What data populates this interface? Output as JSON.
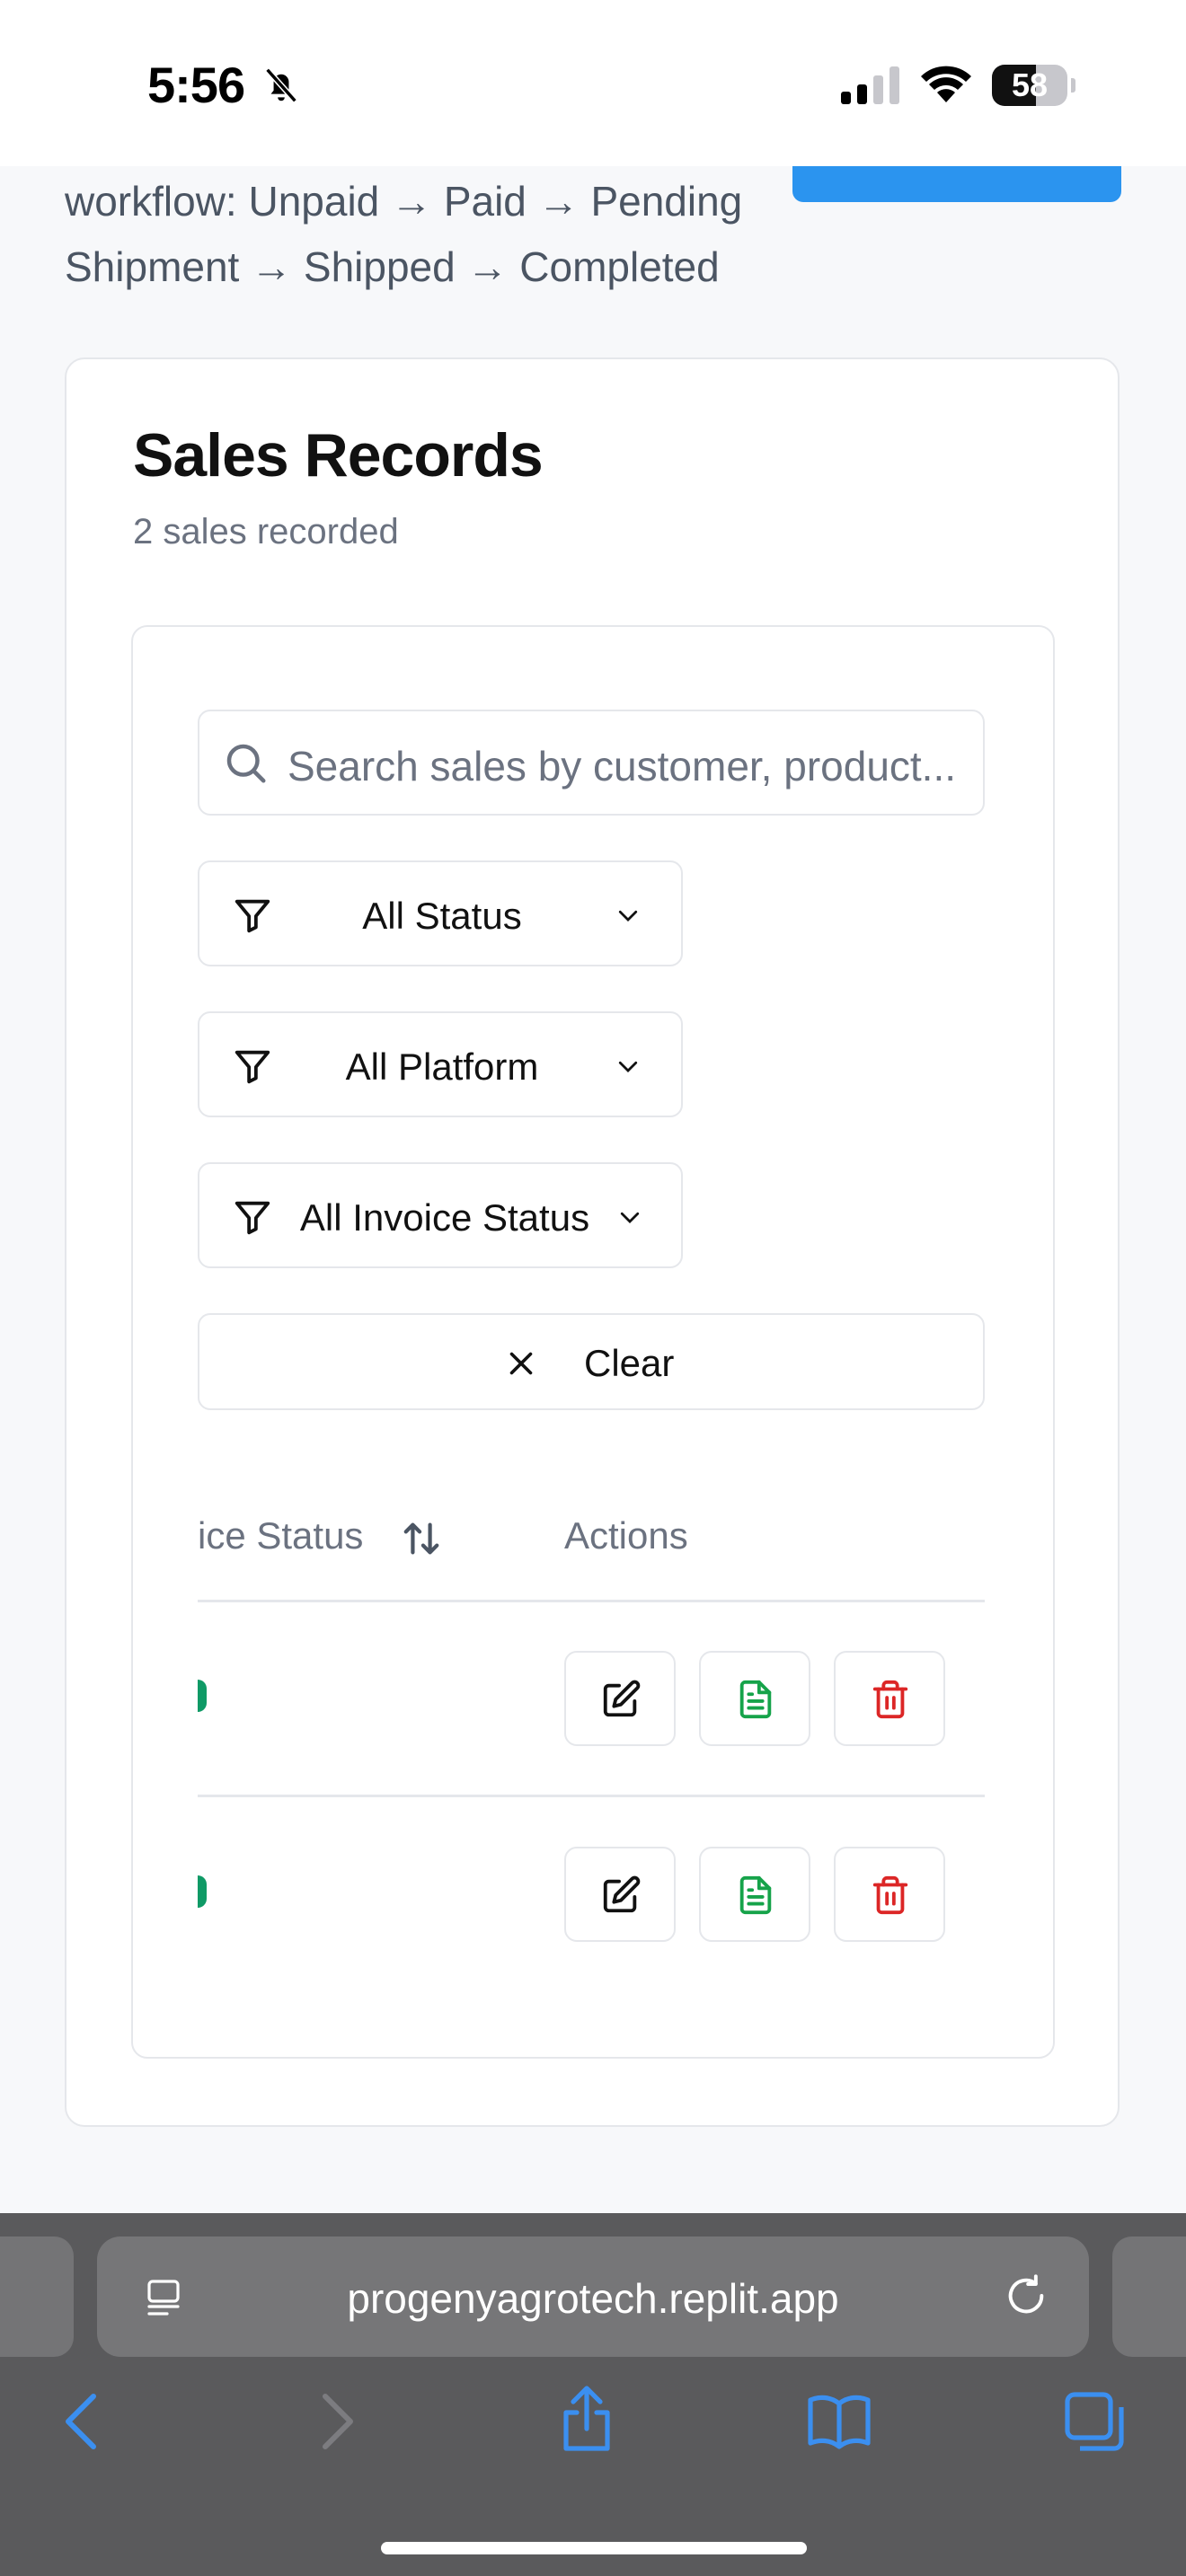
{
  "status_bar": {
    "time": "5:56",
    "battery_level": "58",
    "battery_fraction": 0.58,
    "icons": [
      "bell-slash-icon",
      "cellular-signal-icon",
      "wifi-icon",
      "battery-icon"
    ]
  },
  "intro": {
    "workflow_text": "workflow: Unpaid → Paid → Pending Shipment → Shipped → Completed"
  },
  "sales_card": {
    "title": "Sales Records",
    "subtitle": "2 sales recorded",
    "search": {
      "placeholder": "Search sales by customer, product..."
    },
    "filters": [
      {
        "label": "All Status",
        "icon": "filter-icon"
      },
      {
        "label": "All Platform",
        "icon": "filter-icon"
      },
      {
        "label": "All Invoice Status",
        "icon": "filter-icon"
      }
    ],
    "clear_label": "Clear",
    "table": {
      "columns": [
        "ice Status",
        "Actions"
      ],
      "rows": [
        {
          "actions": [
            "edit-icon",
            "invoice-icon",
            "delete-icon"
          ]
        },
        {
          "actions": [
            "edit-icon",
            "invoice-icon",
            "delete-icon"
          ]
        }
      ]
    }
  },
  "browser": {
    "url": "progenyagrotech.replit.app",
    "toolbar": [
      "back-icon",
      "forward-icon",
      "share-icon",
      "bookmarks-icon",
      "tabs-icon"
    ]
  },
  "colors": {
    "accent_blue": "#2b94ef",
    "success_green": "#16a34a",
    "danger_red": "#dc2626",
    "ios_blue": "#3b8ff0"
  }
}
